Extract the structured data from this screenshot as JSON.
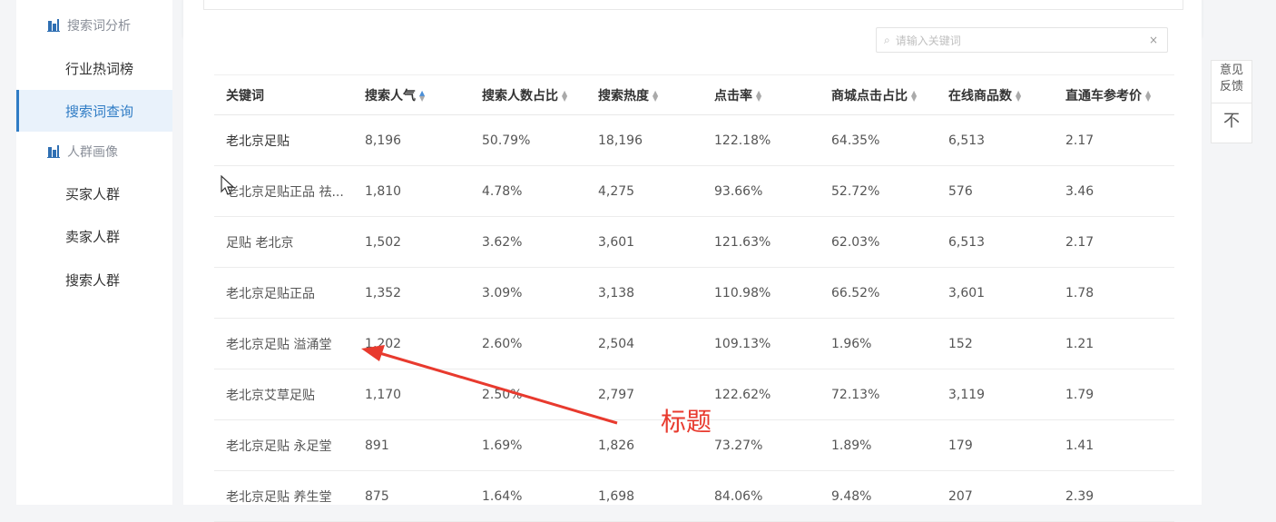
{
  "sidebar": {
    "group_search": "搜索词分析",
    "item_hot": "行业热词榜",
    "item_query": "搜索词查询",
    "group_persona": "人群画像",
    "item_buyer": "买家人群",
    "item_seller": "卖家人群",
    "item_search_crowd": "搜索人群"
  },
  "search": {
    "placeholder": "请输入关键词"
  },
  "table": {
    "headers": [
      "关键词",
      "搜索人气",
      "搜索人数占比",
      "搜索热度",
      "点击率",
      "商城点击占比",
      "在线商品数",
      "直通车参考价"
    ],
    "rows": [
      [
        "老北京足贴",
        "8,196",
        "50.79%",
        "18,196",
        "122.18%",
        "64.35%",
        "6,513",
        "2.17"
      ],
      [
        "老北京足贴正品 祛...",
        "1,810",
        "4.78%",
        "4,275",
        "93.66%",
        "52.72%",
        "576",
        "3.46"
      ],
      [
        "足贴 老北京",
        "1,502",
        "3.62%",
        "3,601",
        "121.63%",
        "62.03%",
        "6,513",
        "2.17"
      ],
      [
        "老北京足贴正品",
        "1,352",
        "3.09%",
        "3,138",
        "110.98%",
        "66.52%",
        "3,601",
        "1.78"
      ],
      [
        "老北京足贴 溢涌堂",
        "1,202",
        "2.60%",
        "2,504",
        "109.13%",
        "1.96%",
        "152",
        "1.21"
      ],
      [
        "老北京艾草足贴",
        "1,170",
        "2.50%",
        "2,797",
        "122.62%",
        "72.13%",
        "3,119",
        "1.79"
      ],
      [
        "老北京足贴 永足堂",
        "891",
        "1.69%",
        "1,826",
        "73.27%",
        "1.89%",
        "179",
        "1.41"
      ],
      [
        "老北京足贴 养生堂",
        "875",
        "1.64%",
        "1,698",
        "84.06%",
        "9.48%",
        "207",
        "2.39"
      ]
    ]
  },
  "float_panel": {
    "feedback": "意见反馈",
    "top": "不"
  },
  "annotation": {
    "label": "标题",
    "color": "#e83a2e"
  }
}
